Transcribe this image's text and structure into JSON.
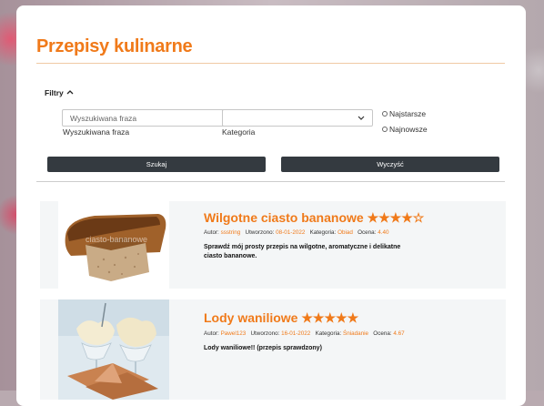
{
  "page": {
    "title": "Przepisy kulinarne"
  },
  "filters": {
    "header": "Filtry",
    "search_placeholder": "Wyszukiwana fraza",
    "search_label": "Wyszukiwana fraza",
    "category_label": "Kategoria",
    "category_value": "",
    "sort_options": [
      "Najstarsze",
      "Najnowsze"
    ],
    "search_button": "Szukaj",
    "clear_button": "Wyczyść"
  },
  "labels": {
    "author": "Autor:",
    "created": "Utworzono:",
    "category": "Kategoria:",
    "rating": "Ocena:"
  },
  "recipes": [
    {
      "title": "Wilgotne ciasto bananowe",
      "stars": "★★★★☆",
      "author": "ssstring",
      "created": "08-01-2022",
      "category": "Obiad",
      "rating": "4.40",
      "description": "Sprawdź mój prosty przepis na wilgotne, aromatyczne i delikatne ciasto bananowe."
    },
    {
      "title": "Lody waniliowe",
      "stars": "★★★★★",
      "author": "Pawel123",
      "created": "16-01-2022",
      "category": "Śniadanie",
      "rating": "4.67",
      "description": "Lody waniliowe!! (przepis sprawdzony)"
    }
  ],
  "colors": {
    "accent": "#f07a1a",
    "button": "#343a40",
    "card_bg": "#f4f6f7"
  }
}
